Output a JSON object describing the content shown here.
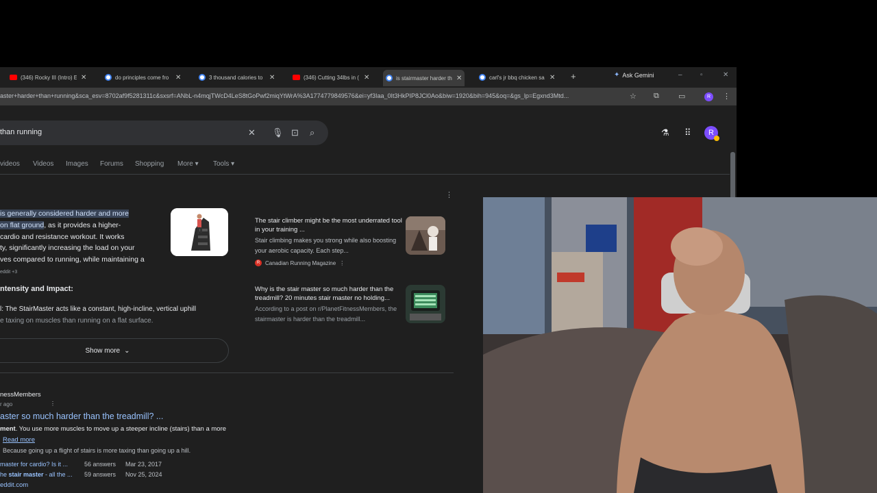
{
  "tabs": [
    {
      "label": "(346) Rocky III (Intro) E",
      "icon": "youtube-icon"
    },
    {
      "label": "do principles come fro",
      "icon": "google-icon"
    },
    {
      "label": "3 thousand calories to",
      "icon": "google-icon"
    },
    {
      "label": "(346) Cutting 34lbs in (",
      "icon": "youtube-icon"
    },
    {
      "label": "is stairmaster harder th",
      "icon": "google-icon",
      "active": true
    },
    {
      "label": "carl's jr bbq chicken sa",
      "icon": "google-icon"
    }
  ],
  "browser": {
    "ask_gemini": "Ask Gemini",
    "url": "aster+harder+than+running&sca_esv=8702af9f5281311c&sxsrf=ANbL-n4mqjTWcD4LeS8tGoPwf2miqYtWrA%3A1774779849576&ei=yf3Iaa_0It3HkPIP8JCl0Ao&biw=1920&bih=945&oq=&gs_lp=Egxnd3Mtd...",
    "profile_initial": "R"
  },
  "search": {
    "query": "than running"
  },
  "nav_tabs": [
    "videos",
    "Videos",
    "Images",
    "Forums",
    "Shopping",
    "More",
    "Tools"
  ],
  "ai_overview": {
    "highlight_1": "is generally considered harder and more",
    "highlight_2": "on flat ground",
    "rest_1": ", as it provides a higher-",
    "line_3": "cardio and resistance workout. It works",
    "line_4": "ty, significantly increasing the load on your",
    "line_5": "ves compared to running, while maintaining a",
    "citation": "eddit +3",
    "section_title": "ntensity and Impact:",
    "section_line_1": "l: The StairMaster acts like a constant, high-incline, vertical uphill",
    "section_line_2": "e taxing on muscles than running on a flat surface.",
    "show_more": "Show more"
  },
  "cards": [
    {
      "title": "The stair climber might be the most underrated tool in your training ...",
      "body": "Stair climbing makes you strong while also boosting your aerobic capacity. Each step...",
      "source": "Canadian Running Magazine"
    },
    {
      "title": "Why is the stair master so much harder than the treadmill? 20 minutes stair master no holding...",
      "body": "According to a post on r/PlanetFitnessMembers, the stairmaster is harder than the treadmill..."
    }
  ],
  "result": {
    "site": "nessMembers",
    "age": "r ago",
    "title": "aster so much harder than the treadmill? ...",
    "snippet_bold": "ment",
    "snippet": ". You use more muscles to move up a steeper incline (stairs) than a more",
    "read_more": "Read more",
    "snippet2": "Because going up a flight of stairs is more taxing than going up a hill.",
    "rows": [
      {
        "link": "master for cardio? Is it ...",
        "answers": "56 answers",
        "date": "Mar 23, 2017"
      },
      {
        "link_pre": "he ",
        "link_bold": "stair master",
        "link_post": " - all the ...",
        "answers": "59 answers",
        "date": "Nov 25, 2024"
      }
    ],
    "more": "eddit.com"
  },
  "colors": {
    "bg": "#1f1f1f",
    "link": "#99c3ff",
    "highlight": "#394457"
  }
}
